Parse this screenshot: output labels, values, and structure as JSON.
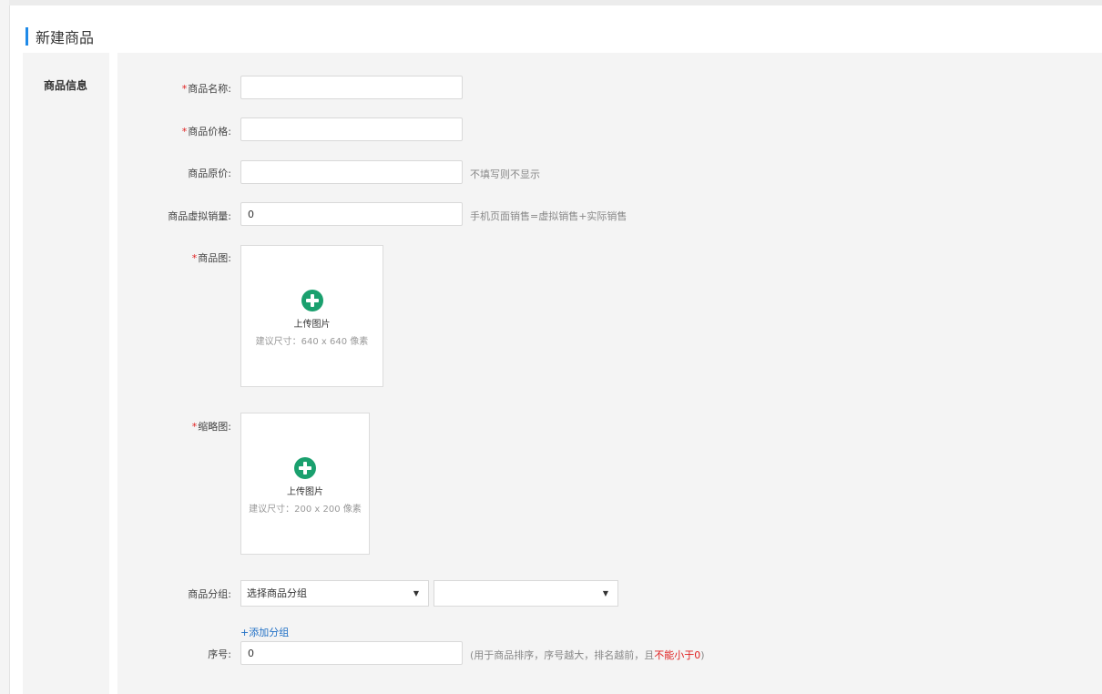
{
  "page": {
    "title": "新建商品"
  },
  "section": {
    "label": "商品信息"
  },
  "form": {
    "name": {
      "label": "商品名称:",
      "required": true,
      "value": ""
    },
    "price": {
      "label": "商品价格:",
      "required": true,
      "value": ""
    },
    "original_price": {
      "label": "商品原价:",
      "required": false,
      "value": "",
      "hint": "不填写则不显示"
    },
    "virtual_sales": {
      "label": "商品虚拟销量:",
      "required": false,
      "value": "0",
      "hint": "手机页面销售=虚拟销售+实际销售"
    },
    "image": {
      "label": "商品图:",
      "required": true,
      "upload_text": "上传图片",
      "size_hint": "建议尺寸：640 x 640 像素"
    },
    "thumbnail": {
      "label": "缩略图:",
      "required": true,
      "upload_text": "上传图片",
      "size_hint": "建议尺寸：200 x 200 像素"
    },
    "group": {
      "label": "商品分组:",
      "primary_selected": "选择商品分组",
      "secondary_selected": "",
      "add_link": "+添加分组"
    },
    "order": {
      "label": "序号:",
      "value": "0",
      "hint_prefix": "(用于商品排序，序号越大，排名越前，且",
      "hint_red": "不能小于0",
      "hint_suffix": ")"
    }
  },
  "colors": {
    "accent": "#1f8ae8",
    "required": "#e02020",
    "upload_icon": "#1aa06e",
    "link": "#1f6fc5"
  }
}
